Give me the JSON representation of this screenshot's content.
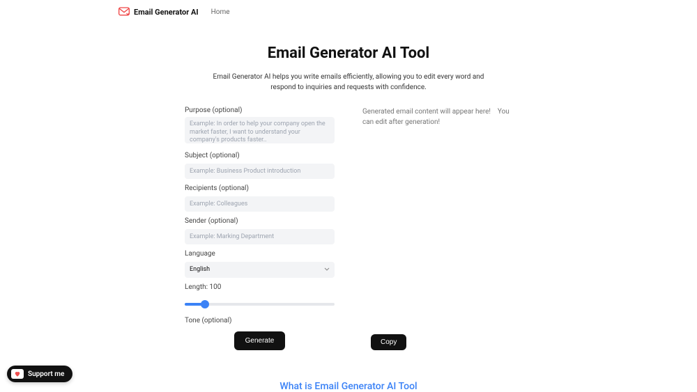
{
  "nav": {
    "brand": "Email Generator AI",
    "home": "Home"
  },
  "hero": {
    "title": "Email Generator AI Tool",
    "desc": "Email Generator AI helps you write emails efficiently, allowing you to edit every word and respond to inquiries and requests with confidence."
  },
  "form": {
    "purpose_label": "Purpose (optional)",
    "purpose_placeholder": "Example: In order to help your company open the market faster, I want to understand your company's products faster..",
    "subject_label": "Subject (optional)",
    "subject_placeholder": "Example: Business Product introduction",
    "recipients_label": "Recipients (optional)",
    "recipients_placeholder": "Example: Colleagues",
    "sender_label": "Sender (optional)",
    "sender_placeholder": "Example: Marking Department",
    "language_label": "Language",
    "language_value": "English",
    "length_label_prefix": "Length: ",
    "length_value": "100",
    "length_min": "50",
    "length_max": "500",
    "tone_label": "Tone (optional)",
    "generate": "Generate"
  },
  "output": {
    "placeholder": "Generated email content will appear here!    You can edit after generation!",
    "copy": "Copy"
  },
  "footer": {
    "heading": "What is Email Generator AI Tool"
  },
  "support": {
    "label": "Support me"
  }
}
